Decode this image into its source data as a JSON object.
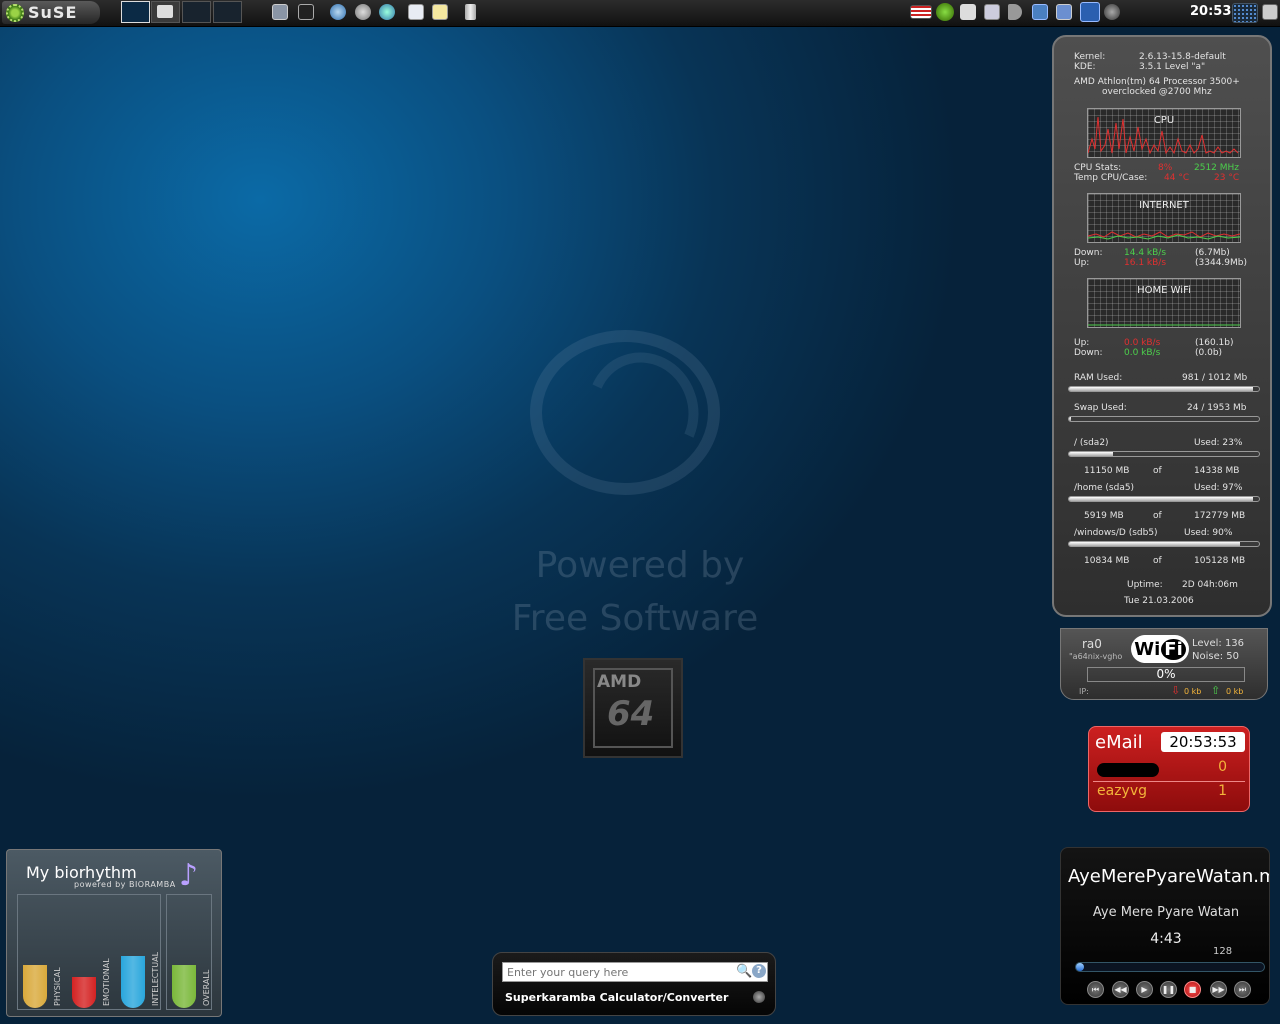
{
  "panel": {
    "kmenu_label": "SuSE",
    "clock": "20:53",
    "tray_flag": "us",
    "icons": [
      "monitor-icon",
      "terminal-icon",
      "konqueror-icon",
      "network-icon",
      "kopete-icon",
      "document-icon",
      "editor-icon",
      "trash-icon"
    ]
  },
  "wallpaper": {
    "line1": "Powered by",
    "line2": "Free Software",
    "chip_brand": "AMD",
    "chip_model": "64"
  },
  "sysmon": {
    "kernel_label": "Kernel:",
    "kernel_value": "2.6.13-15.8-default",
    "kde_label": "KDE:",
    "kde_value": "3.5.1 Level \"a\"",
    "cpu_model": "AMD Athlon(tm) 64 Processor 3500+",
    "cpu_note": "overclocked @2700 Mhz",
    "cpu_graph_title": "CPU",
    "cpu_stats_label": "CPU Stats:",
    "cpu_stats_pct": "8%",
    "cpu_stats_mhz": "2512 MHz",
    "temp_label": "Temp CPU/Case:",
    "temp_cpu": "44 °C",
    "temp_case": "23 °C",
    "internet_graph_title": "INTERNET",
    "inet_down_label": "Down:",
    "inet_down_rate": "14.4 kB/s",
    "inet_down_total": "(6.7Mb)",
    "inet_up_label": "Up:",
    "inet_up_rate": "16.1 kB/s",
    "inet_up_total": "(3344.9Mb)",
    "wifi_graph_title": "HOME WiFi",
    "wifi_up_label": "Up:",
    "wifi_up_rate": "0.0 kB/s",
    "wifi_up_total": "(160.1b)",
    "wifi_down_label": "Down:",
    "wifi_down_rate": "0.0 kB/s",
    "wifi_down_total": "(0.0b)",
    "ram_label": "RAM Used:",
    "ram_value": "981 / 1012 Mb",
    "ram_fraction": 0.97,
    "swap_label": "Swap Used:",
    "swap_value": "24 / 1953 Mb",
    "swap_fraction": 0.012,
    "disks": [
      {
        "name": "/ (sda2)",
        "used": "Used: 23%",
        "used_mb": "11150 MB",
        "of": "of",
        "total_mb": "14338 MB",
        "fraction": 0.23
      },
      {
        "name": "/home (sda5)",
        "used": "Used: 97%",
        "used_mb": "5919 MB",
        "of": "of",
        "total_mb": "172779 MB",
        "fraction": 0.97
      },
      {
        "name": "/windows/D (sdb5)",
        "used": "Used: 90%",
        "used_mb": "10834 MB",
        "of": "of",
        "total_mb": "105128 MB",
        "fraction": 0.9
      }
    ],
    "uptime_label": "Uptime:",
    "uptime_value": "2D  04h:06m",
    "date": "Tue 21.03.2006"
  },
  "wifi": {
    "iface": "ra0",
    "essid": "\"a64nix-vgho",
    "logo_wi": "Wi",
    "logo_fi": "Fi",
    "level_label": "Level: 136",
    "noise_label": "Noise: 50",
    "signal": "0%",
    "ip_label": "IP:",
    "down": "0 kb",
    "up": "0 kb"
  },
  "email": {
    "title": "eMail",
    "time": "20:53:53",
    "accounts": [
      {
        "name": "",
        "count": "0"
      },
      {
        "name": "eazyvg",
        "count": "1"
      }
    ]
  },
  "player": {
    "file": "AyeMerePyareWatan.m",
    "title": "Aye Mere Pyare Watan",
    "time": "4:43",
    "bitrate": "128",
    "progress": 0.04
  },
  "bio": {
    "title": "My biorhythm",
    "powered": "powered by BIORAMBA",
    "bars": [
      {
        "label": "PHYSICAL",
        "level": 0.38,
        "color": "#d9a93b"
      },
      {
        "label": "EMOTIONAL",
        "level": 0.28,
        "color": "#d42222"
      },
      {
        "label": "INTELECTUAL",
        "level": 0.46,
        "color": "#29a6dc"
      },
      {
        "label": "OVERALL",
        "level": 0.38,
        "color": "#7ab83a"
      }
    ]
  },
  "calc": {
    "placeholder": "Enter your query here",
    "label": "Superkaramba Calculator/Converter"
  }
}
